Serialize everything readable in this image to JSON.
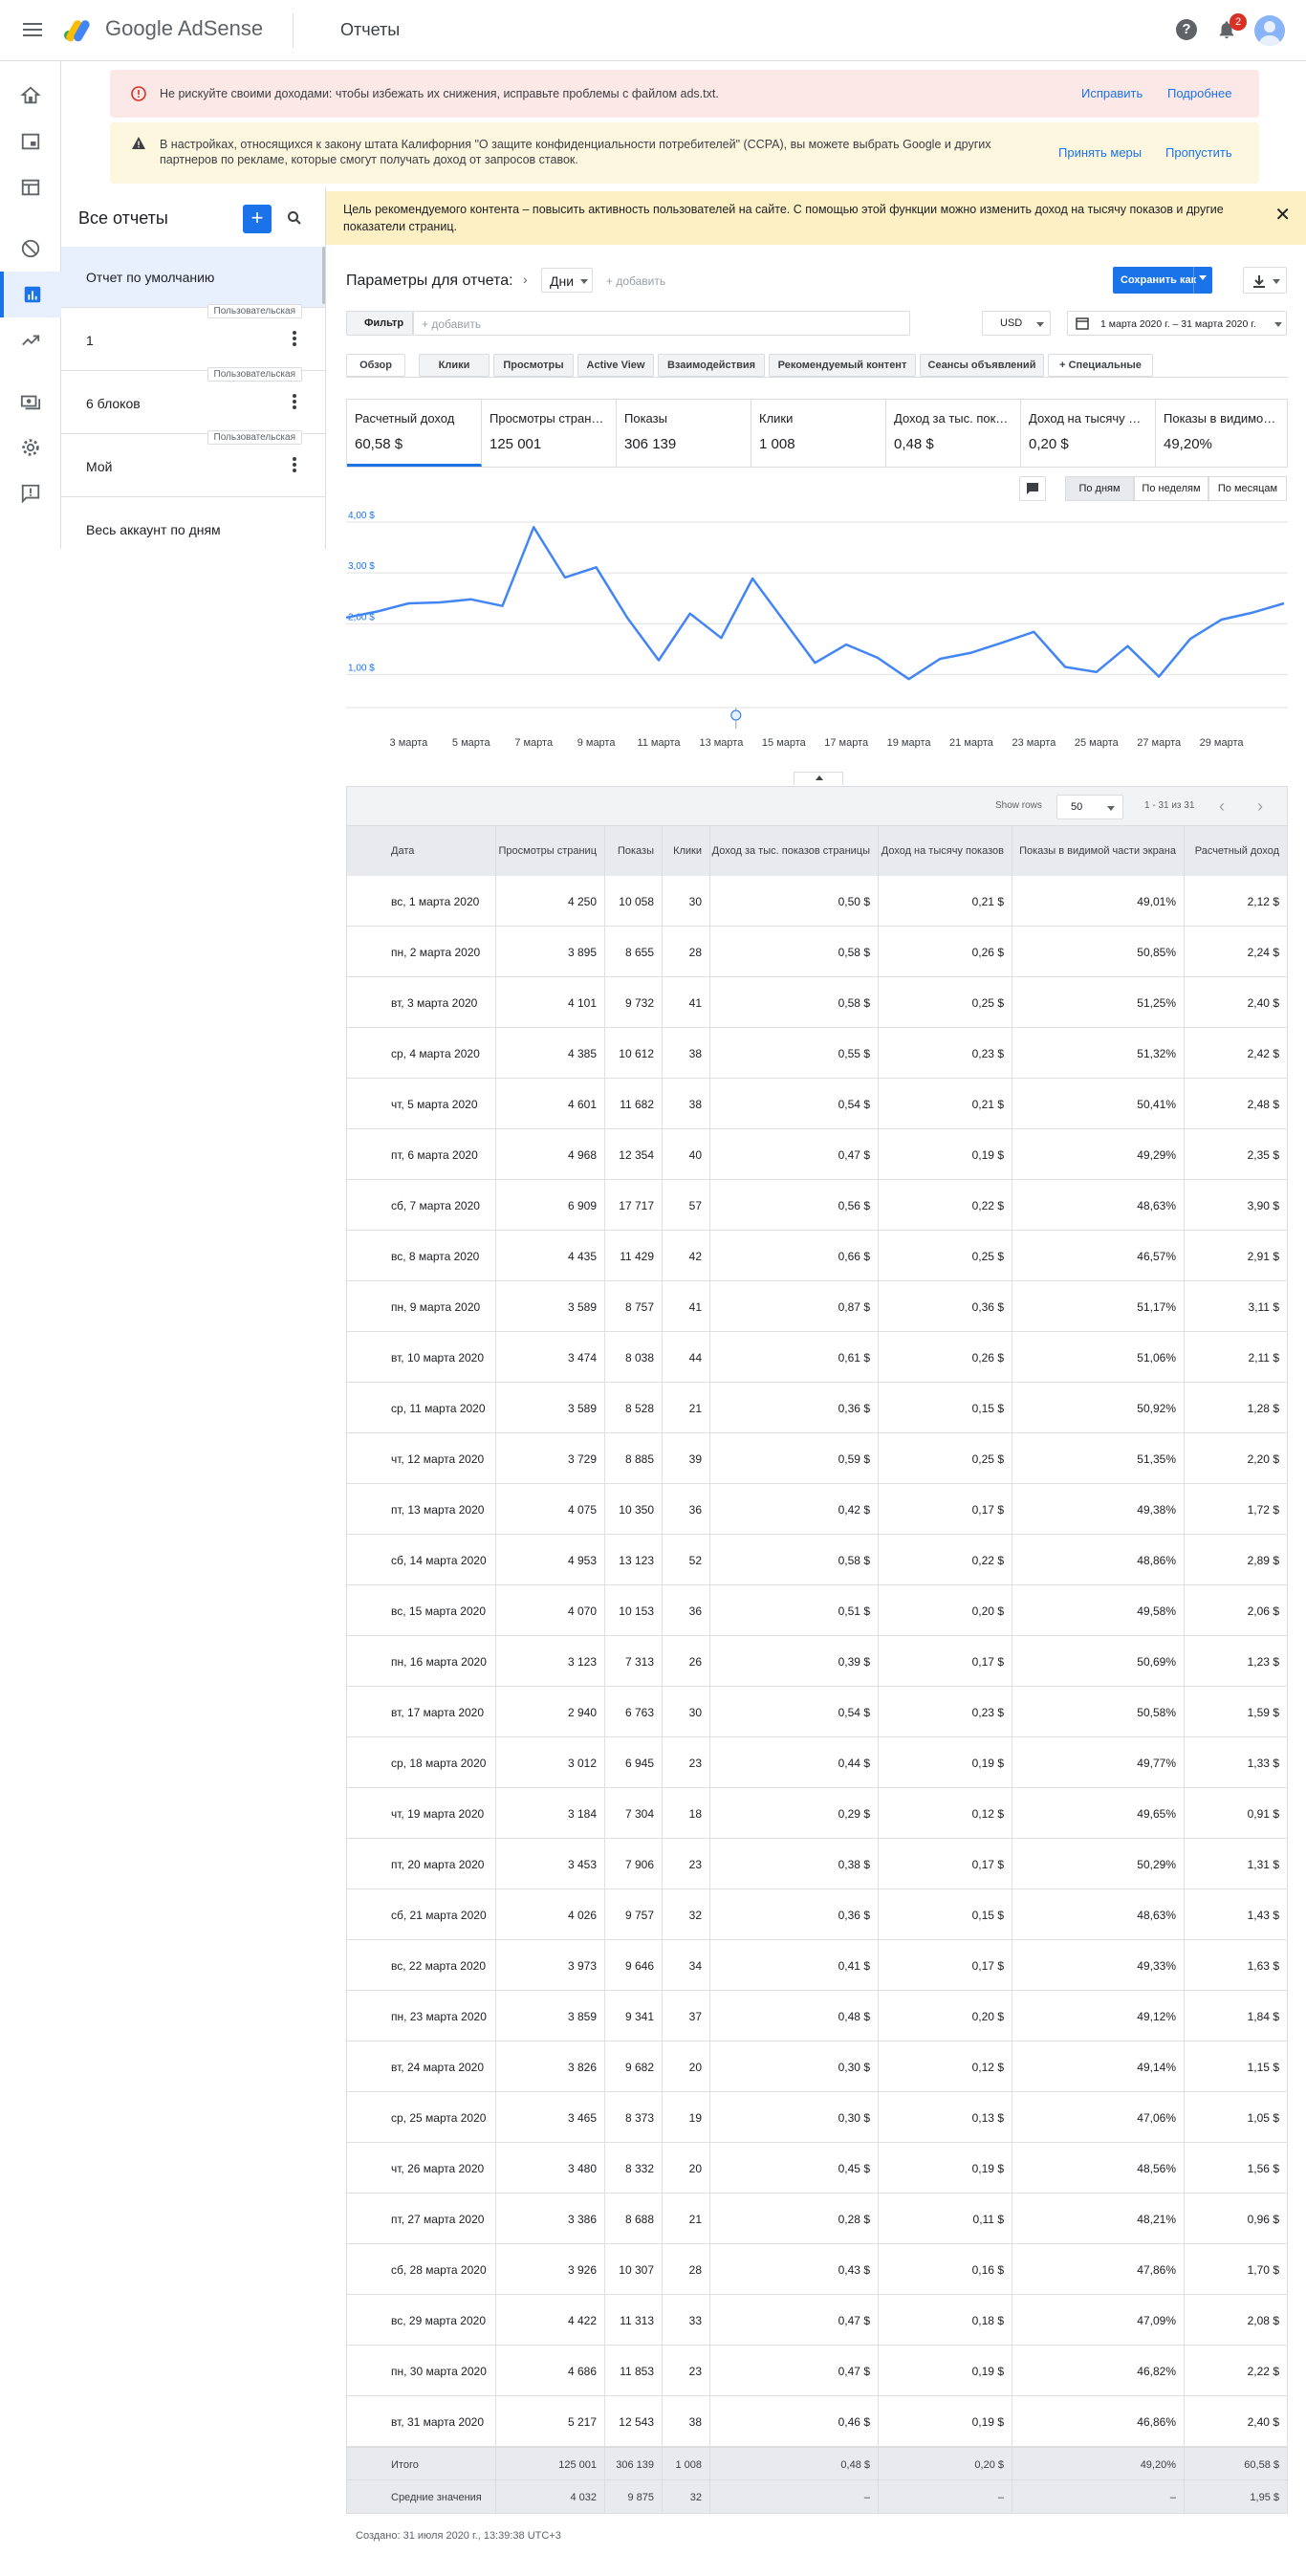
{
  "app": {
    "brand": "Google AdSense",
    "page_title": "Отчеты",
    "notifications": "2"
  },
  "alerts": {
    "ads_txt": {
      "text": "Не рискуйте своими доходами: чтобы избежать их снижения, исправьте проблемы с файлом ads.txt.",
      "fix": "Исправить",
      "more": "Подробнее"
    },
    "ccpa": {
      "text": "В настройках, относящихся к закону штата Калифорния \"О защите конфиденциальности потребителей\" (CCPA), вы можете выбрать Google и других партнеров по рекламе, которые смогут получать доход от запросов ставок.",
      "act": "Принять меры",
      "skip": "Пропустить"
    }
  },
  "sidebar": {
    "heading": "Все отчеты",
    "items": [
      {
        "label": "Отчет по умолчанию",
        "tag": ""
      },
      {
        "label": "1",
        "tag": "Пользовательская"
      },
      {
        "label": "6 блоков",
        "tag": "Пользовательская"
      },
      {
        "label": "Мой",
        "tag": "Пользовательская"
      },
      {
        "label": "Весь аккаунт по дням",
        "tag": ""
      }
    ]
  },
  "banner": {
    "text": "Цель рекомендуемого контента – повысить активность пользователей на сайте. С помощью этой функции можно изменить доход на тысячу показов и другие показатели страниц."
  },
  "report": {
    "params_label": "Параметры для отчета:",
    "dimension": "Дни",
    "add_dim": "+ добавить",
    "save_as": "Сохранить как",
    "filter": "Фильтр",
    "filter_placeholder": "+ добавить",
    "currency": "USD",
    "date_range": "1 марта 2020 г. – 31 марта 2020 г.",
    "tabs": [
      "Обзор",
      "Клики",
      "Просмотры",
      "Active View",
      "Взаимодействия",
      "Рекомендуемый контент",
      "Сеансы объявлений",
      "+  Специальные"
    ]
  },
  "metrics": [
    {
      "title": "Расчетный доход",
      "value": "60,58 $"
    },
    {
      "title": "Просмотры стран…",
      "value": "125 001"
    },
    {
      "title": "Показы",
      "value": "306 139"
    },
    {
      "title": "Клики",
      "value": "1 008"
    },
    {
      "title": "Доход за тыс. пок…",
      "value": "0,48 $"
    },
    {
      "title": "Доход на тысячу …",
      "value": "0,20 $"
    },
    {
      "title": "Показы в видимо…",
      "value": "49,20%"
    }
  ],
  "granularity": [
    "По дням",
    "По неделям",
    "По месяцам"
  ],
  "chart_data": {
    "type": "line",
    "x": [
      "1 марта",
      "2 марта",
      "3 марта",
      "4 марта",
      "5 марта",
      "6 марта",
      "7 марта",
      "8 марта",
      "9 марта",
      "10 марта",
      "11 марта",
      "12 марта",
      "13 марта",
      "14 марта",
      "15 марта",
      "16 марта",
      "17 марта",
      "18 марта",
      "19 марта",
      "20 марта",
      "21 марта",
      "22 марта",
      "23 марта",
      "24 марта",
      "25 марта",
      "26 марта",
      "27 марта",
      "28 марта",
      "29 марта",
      "30 марта",
      "31 марта"
    ],
    "x_tick_labels": [
      "3 марта",
      "5 марта",
      "7 марта",
      "9 марта",
      "11 марта",
      "13 марта",
      "15 марта",
      "17 марта",
      "19 марта",
      "21 марта",
      "23 марта",
      "25 марта",
      "27 марта",
      "29 марта"
    ],
    "y_tick_labels": [
      "4,00 $",
      "3,00 $",
      "2,00 $",
      "1,00 $"
    ],
    "ylim": [
      0.5,
      4.0
    ],
    "series": [
      {
        "values": [
          2.12,
          2.24,
          2.4,
          2.42,
          2.48,
          2.35,
          3.9,
          2.91,
          3.11,
          2.11,
          1.28,
          2.2,
          1.72,
          2.89,
          2.06,
          1.23,
          1.59,
          1.33,
          0.91,
          1.31,
          1.43,
          1.63,
          1.84,
          1.15,
          1.05,
          1.56,
          0.96,
          1.7,
          2.08,
          2.22,
          2.4
        ],
        "color": "#4285f4"
      }
    ],
    "grid": true
  },
  "table": {
    "show_rows_label": "Show rows",
    "rows_per_page": "50",
    "pagination": "1 - 31 из 31",
    "headers": [
      "Дата",
      "Просмотры страниц",
      "Показы",
      "Клики",
      "Доход за тыс. показов страницы",
      "Доход на тысячу показов",
      "Показы в видимой части экрана",
      "Расчетный доход"
    ],
    "rows": [
      [
        "вс, 1 марта 2020",
        "4 250",
        "10 058",
        "30",
        "0,50 $",
        "0,21 $",
        "49,01%",
        "2,12 $"
      ],
      [
        "пн, 2 марта 2020",
        "3 895",
        "8 655",
        "28",
        "0,58 $",
        "0,26 $",
        "50,85%",
        "2,24 $"
      ],
      [
        "вт, 3 марта 2020",
        "4 101",
        "9 732",
        "41",
        "0,58 $",
        "0,25 $",
        "51,25%",
        "2,40 $"
      ],
      [
        "ср, 4 марта 2020",
        "4 385",
        "10 612",
        "38",
        "0,55 $",
        "0,23 $",
        "51,32%",
        "2,42 $"
      ],
      [
        "чт, 5 марта 2020",
        "4 601",
        "11 682",
        "38",
        "0,54 $",
        "0,21 $",
        "50,41%",
        "2,48 $"
      ],
      [
        "пт, 6 марта 2020",
        "4 968",
        "12 354",
        "40",
        "0,47 $",
        "0,19 $",
        "49,29%",
        "2,35 $"
      ],
      [
        "сб, 7 марта 2020",
        "6 909",
        "17 717",
        "57",
        "0,56 $",
        "0,22 $",
        "48,63%",
        "3,90 $"
      ],
      [
        "вс, 8 марта 2020",
        "4 435",
        "11 429",
        "42",
        "0,66 $",
        "0,25 $",
        "46,57%",
        "2,91 $"
      ],
      [
        "пн, 9 марта 2020",
        "3 589",
        "8 757",
        "41",
        "0,87 $",
        "0,36 $",
        "51,17%",
        "3,11 $"
      ],
      [
        "вт, 10 марта 2020",
        "3 474",
        "8 038",
        "44",
        "0,61 $",
        "0,26 $",
        "51,06%",
        "2,11 $"
      ],
      [
        "ср, 11 марта 2020",
        "3 589",
        "8 528",
        "21",
        "0,36 $",
        "0,15 $",
        "50,92%",
        "1,28 $"
      ],
      [
        "чт, 12 марта 2020",
        "3 729",
        "8 885",
        "39",
        "0,59 $",
        "0,25 $",
        "51,35%",
        "2,20 $"
      ],
      [
        "пт, 13 марта 2020",
        "4 075",
        "10 350",
        "36",
        "0,42 $",
        "0,17 $",
        "49,38%",
        "1,72 $"
      ],
      [
        "сб, 14 марта 2020",
        "4 953",
        "13 123",
        "52",
        "0,58 $",
        "0,22 $",
        "48,86%",
        "2,89 $"
      ],
      [
        "вс, 15 марта 2020",
        "4 070",
        "10 153",
        "36",
        "0,51 $",
        "0,20 $",
        "49,58%",
        "2,06 $"
      ],
      [
        "пн, 16 марта 2020",
        "3 123",
        "7 313",
        "26",
        "0,39 $",
        "0,17 $",
        "50,69%",
        "1,23 $"
      ],
      [
        "вт, 17 марта 2020",
        "2 940",
        "6 763",
        "30",
        "0,54 $",
        "0,23 $",
        "50,58%",
        "1,59 $"
      ],
      [
        "ср, 18 марта 2020",
        "3 012",
        "6 945",
        "23",
        "0,44 $",
        "0,19 $",
        "49,77%",
        "1,33 $"
      ],
      [
        "чт, 19 марта 2020",
        "3 184",
        "7 304",
        "18",
        "0,29 $",
        "0,12 $",
        "49,65%",
        "0,91 $"
      ],
      [
        "пт, 20 марта 2020",
        "3 453",
        "7 906",
        "23",
        "0,38 $",
        "0,17 $",
        "50,29%",
        "1,31 $"
      ],
      [
        "сб, 21 марта 2020",
        "4 026",
        "9 757",
        "32",
        "0,36 $",
        "0,15 $",
        "48,63%",
        "1,43 $"
      ],
      [
        "вс, 22 марта 2020",
        "3 973",
        "9 646",
        "34",
        "0,41 $",
        "0,17 $",
        "49,33%",
        "1,63 $"
      ],
      [
        "пн, 23 марта 2020",
        "3 859",
        "9 341",
        "37",
        "0,48 $",
        "0,20 $",
        "49,12%",
        "1,84 $"
      ],
      [
        "вт, 24 марта 2020",
        "3 826",
        "9 682",
        "20",
        "0,30 $",
        "0,12 $",
        "49,14%",
        "1,15 $"
      ],
      [
        "ср, 25 марта 2020",
        "3 465",
        "8 373",
        "19",
        "0,30 $",
        "0,13 $",
        "47,06%",
        "1,05 $"
      ],
      [
        "чт, 26 марта 2020",
        "3 480",
        "8 332",
        "20",
        "0,45 $",
        "0,19 $",
        "48,56%",
        "1,56 $"
      ],
      [
        "пт, 27 марта 2020",
        "3 386",
        "8 688",
        "21",
        "0,28 $",
        "0,11 $",
        "48,21%",
        "0,96 $"
      ],
      [
        "сб, 28 марта 2020",
        "3 926",
        "10 307",
        "28",
        "0,43 $",
        "0,16 $",
        "47,86%",
        "1,70 $"
      ],
      [
        "вс, 29 марта 2020",
        "4 422",
        "11 313",
        "33",
        "0,47 $",
        "0,18 $",
        "47,09%",
        "2,08 $"
      ],
      [
        "пн, 30 марта 2020",
        "4 686",
        "11 853",
        "23",
        "0,47 $",
        "0,19 $",
        "46,82%",
        "2,22 $"
      ],
      [
        "вт, 31 марта 2020",
        "5 217",
        "12 543",
        "38",
        "0,46 $",
        "0,19 $",
        "46,86%",
        "2,40 $"
      ]
    ],
    "totals": [
      "Итого",
      "125 001",
      "306 139",
      "1 008",
      "0,48 $",
      "0,20 $",
      "49,20%",
      "60,58 $"
    ],
    "averages": [
      "Средние значения",
      "4 032",
      "9 875",
      "32",
      "–",
      "–",
      "–",
      "1,95 $"
    ]
  },
  "created": "Создано: 31 июля 2020 г., 13:39:38 UTC+3"
}
